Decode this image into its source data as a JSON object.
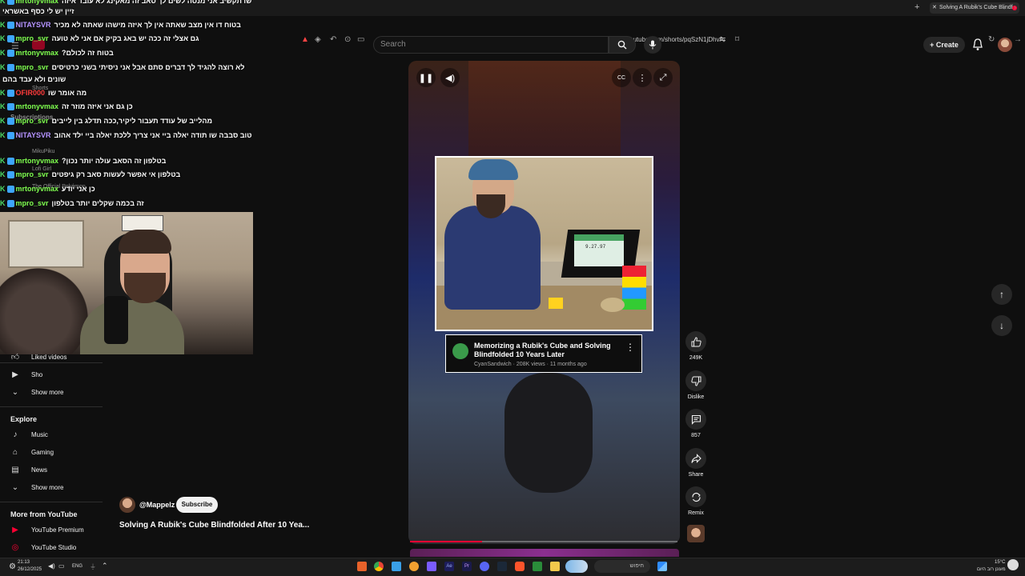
{
  "browser": {
    "tab_title": "Solving A Rubik's Cube Blindf",
    "url": "youtube.com/shorts/pqSzN1jDhvA"
  },
  "header": {
    "search_placeholder": "Search",
    "create_label": "Create"
  },
  "chat": [
    {
      "user": "mrtonyvmax",
      "color": "green",
      "text": "שו תקשיב אני מנסה לשים לך סאב זה מאקינג לא עובד איזה"
    },
    {
      "user": "",
      "color": "green",
      "text": "זיין יש לי כסף באשראי"
    },
    {
      "user": "NITAYSVR",
      "color": "violet",
      "text": "בטוח דו אין מצב שאתה אין לך איזה מישהו שאתה לא מכיר"
    },
    {
      "user": "mpro_svr",
      "color": "green",
      "text": "גם אצלי זה ככה יש באג בקיק אם אני לא טועה"
    },
    {
      "user": "mrtonyvmax",
      "color": "green",
      "text": "בטוח זה לכולם?"
    },
    {
      "user": "mpro_svr",
      "color": "green",
      "text": "לא רוצה להגיד לך דברים סתם אבל אני ניסיתי בשני כרטיסים"
    },
    {
      "user": "",
      "color": "green",
      "text": "שונים ולא עבד בהם"
    },
    {
      "user": "OFIR000",
      "color": "red",
      "text": "מה אומר שו"
    },
    {
      "user": "mrtonyvmax",
      "color": "green",
      "text": "כן גם אני איזה מוזר זה"
    },
    {
      "user": "mpro_svr",
      "color": "green",
      "text": "מהלייב של עודד תעבור ליקיר,ככה תדלג בין לייבים"
    },
    {
      "user": "NITAYSVR",
      "color": "violet",
      "text": "טוב סבבה שו תודה יאלה ביי אני צריך ללכת יאלה ביי ילד אהוב"
    },
    {
      "user": "mrtonyvmax",
      "color": "green",
      "text": "בטלפון זה הסאב עולה יותר נכון?"
    },
    {
      "user": "mpro_svr",
      "color": "green",
      "text": "בטלפון אי אפשר לעשות סאב רק גיפטים"
    },
    {
      "user": "mrtonyvmax",
      "color": "green",
      "text": "כן אני יודע"
    },
    {
      "user": "mpro_svr",
      "color": "green",
      "text": "זה בכמה שקלים יותר בטלפון"
    }
  ],
  "sidebar": {
    "faded_items": [
      "Shorts",
      "Subscriptions",
      "MikuPiku",
      "Lofi Girl",
      "The Official Pokémon"
    ],
    "you_items": [
      {
        "label": "Liked videos",
        "icon": "thumb-up-icon"
      },
      {
        "label": "Sho",
        "icon": "play-square-icon"
      },
      {
        "label": "Show more",
        "icon": "chevron-down-icon"
      }
    ],
    "explore_heading": "Explore",
    "explore_items": [
      {
        "label": "Music",
        "icon": "music-note-icon"
      },
      {
        "label": "Gaming",
        "icon": "gamepad-icon"
      },
      {
        "label": "News",
        "icon": "news-icon"
      },
      {
        "label": "Show more",
        "icon": "chevron-down-icon"
      }
    ],
    "more_heading": "More from YouTube",
    "more_items": [
      {
        "label": "YouTube Premium",
        "icon": "youtube-premium-icon"
      },
      {
        "label": "YouTube Studio",
        "icon": "youtube-studio-icon"
      }
    ]
  },
  "player": {
    "card_title": "Memorizing a Rubik's Cube and Solving Blindfolded 10 Years Later",
    "card_meta": "CyanSandwich · 208K views · 11 months ago",
    "progress_fraction": 0.27,
    "laptop_time": "9.27.97"
  },
  "actions": {
    "like_count": "249K",
    "dislike_label": "Dislike",
    "comments_count": "857",
    "share_label": "Share",
    "remix_label": "Remix"
  },
  "channel": {
    "handle": "@Mappelz",
    "subscribe_label": "Subscribe",
    "video_title": "Solving A Rubik's Cube Blindfolded After 10 Yea..."
  },
  "taskbar": {
    "time": "21:13",
    "date": "26/12/2025",
    "lang": "ENG",
    "search_text": "חיפוש",
    "weather_temp": "15°C",
    "weather_text": "מעונן רוב היום"
  }
}
